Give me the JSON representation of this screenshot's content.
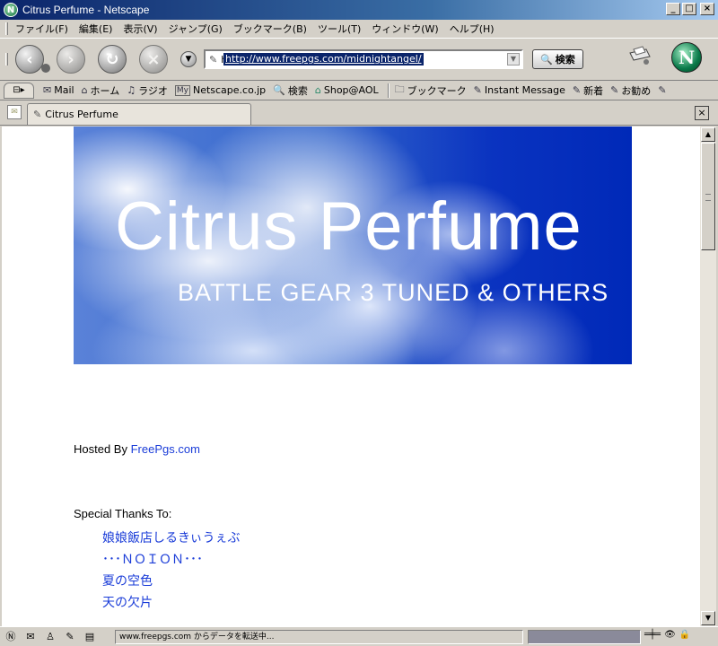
{
  "window": {
    "title": "Citrus Perfume - Netscape"
  },
  "menu": [
    "ファイル(F)",
    "編集(E)",
    "表示(V)",
    "ジャンプ(G)",
    "ブックマーク(B)",
    "ツール(T)",
    "ウィンドウ(W)",
    "ヘルプ(H)"
  ],
  "nav": {
    "url": "http://www.freepgs.com/midnightangel/",
    "search_label": "検索"
  },
  "personal_toolbar": {
    "items": [
      "Mail",
      "ホーム",
      "ラジオ",
      "Netscape.co.jp",
      "検索",
      "Shop@AOL"
    ],
    "bookmarks": [
      "ブックマーク",
      "Instant Message",
      "新着",
      "お勧め"
    ]
  },
  "tab": {
    "label": "Citrus Perfume"
  },
  "page": {
    "banner_title": "Citrus Perfume",
    "banner_subtitle": "BATTLE GEAR 3 TUNED & OTHERS",
    "hosted_prefix": "Hosted By ",
    "hosted_link": "FreePgs.com",
    "thanks_title": "Special Thanks To:",
    "thanks": [
      "娘娘飯店しるきぃうぇぶ",
      "･･･ＮＯＩＯＮ･･･",
      "夏の空色",
      "天の欠片"
    ]
  },
  "status": {
    "text": "www.freepgs.com からデータを転送中...",
    "progress": 1.0
  }
}
